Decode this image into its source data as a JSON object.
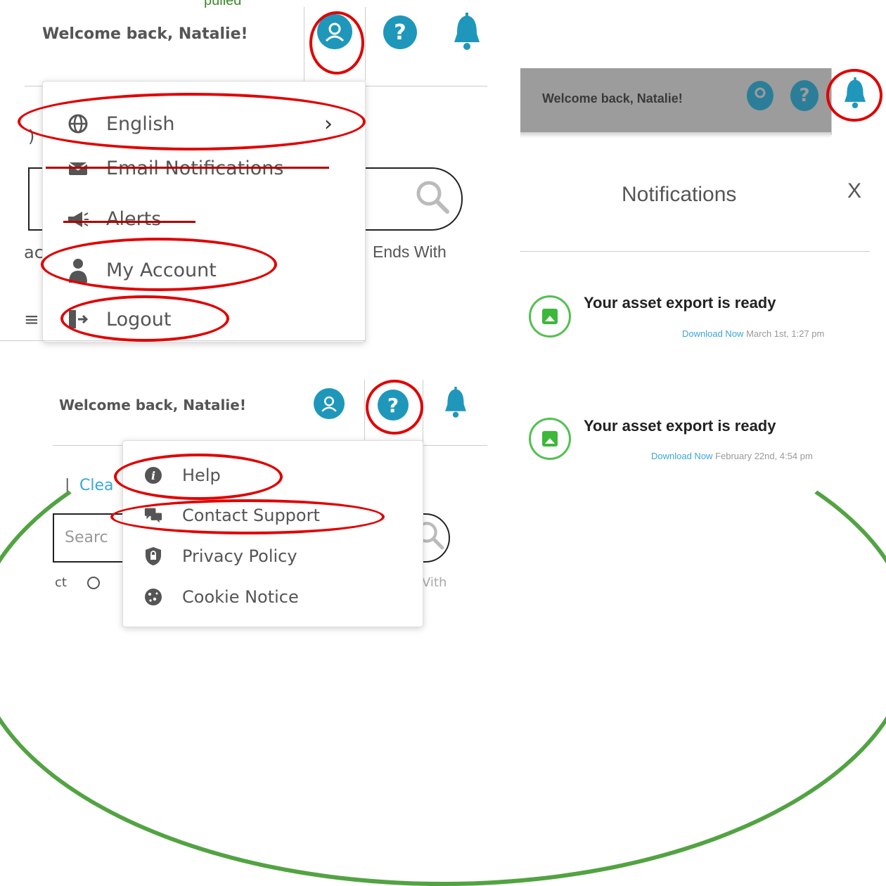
{
  "caption": "pulled",
  "top_left": {
    "welcome": "Welcome back, Natalie!",
    "menu_items": [
      {
        "label": "English",
        "icon": "globe-icon"
      },
      {
        "label": "Email Notifications",
        "icon": "envelope-icon"
      },
      {
        "label": "Alerts",
        "icon": "megaphone-icon"
      },
      {
        "label": "My Account",
        "icon": "user-icon"
      },
      {
        "label": "Logout",
        "icon": "logout-icon"
      }
    ],
    "background_text": {
      "paren": ")",
      "ends_with": "Ends With",
      "ac": "ac"
    }
  },
  "right_panel": {
    "welcome": "Welcome back, Natalie!",
    "title": "Notifications",
    "close": "X",
    "notifications": [
      {
        "title": "Your asset export is ready",
        "link": "Download Now",
        "time": "March 1st, 1:27 pm"
      },
      {
        "title": "Your asset export is ready",
        "link": "Download Now",
        "time": "February 22nd, 4:54 pm"
      }
    ]
  },
  "bottom_left": {
    "welcome": "Welcome back, Natalie!",
    "menu_items": [
      {
        "label": "Help",
        "icon": "info-icon"
      },
      {
        "label": "Contact Support",
        "icon": "chat-icon"
      },
      {
        "label": "Privacy Policy",
        "icon": "shield-icon"
      },
      {
        "label": "Cookie Notice",
        "icon": "cookie-icon"
      }
    ],
    "background_text": {
      "pipe": "|",
      "clear": "Clea",
      "search": "Searc",
      "ct": "ct",
      "with": "Vith"
    }
  },
  "colors": {
    "accent": "#1f97bb",
    "highlight": "#e00000",
    "arc": "#52a342"
  }
}
